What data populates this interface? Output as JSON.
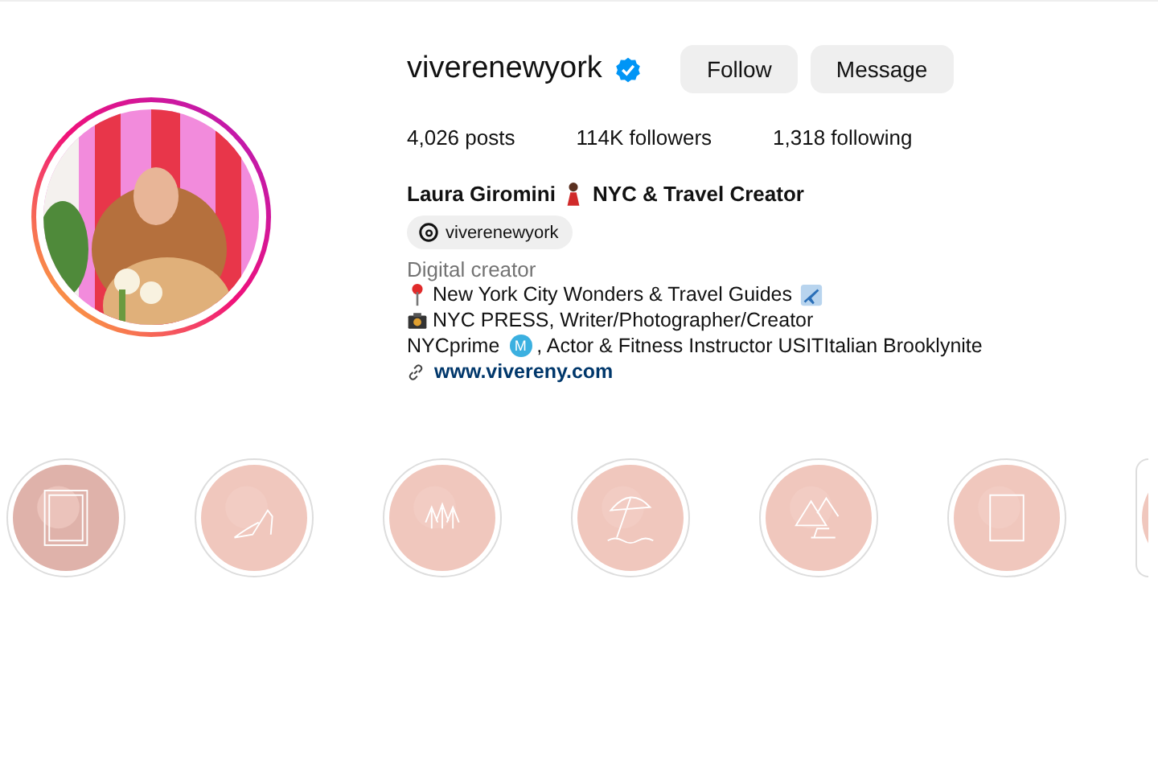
{
  "profile": {
    "username": "viverenewyork",
    "verified": true,
    "buttons": [
      {
        "label": "Follow"
      },
      {
        "label": "Message"
      }
    ],
    "stats": [
      {
        "text": "4,026 posts"
      },
      {
        "text": "114K followers"
      },
      {
        "text": "1,318 following"
      }
    ],
    "name_before": "Laura Giromini",
    "name_after": "NYC & Travel Creator",
    "threads_handle": "viverenewyork",
    "category": "Digital creator",
    "bio": [
      {
        "kind": "pin",
        "text": "New York City Wonders & Travel Guides"
      },
      {
        "kind": "camera",
        "text": "NYC PRESS, Writer/Photographer/Creator"
      },
      {
        "kind": "metro",
        "before": "NYCprime",
        "badge": "M",
        "text": ", Actor & Fitness Instructor USITItalian Brooklynite"
      }
    ],
    "link": "www.vivereny.com"
  },
  "highlights": [
    {
      "kind": "frame"
    },
    {
      "kind": "shoe"
    },
    {
      "kind": "trees"
    },
    {
      "kind": "umbrella"
    },
    {
      "kind": "pyramids"
    },
    {
      "kind": "frame2"
    },
    {
      "kind": "partial"
    }
  ]
}
